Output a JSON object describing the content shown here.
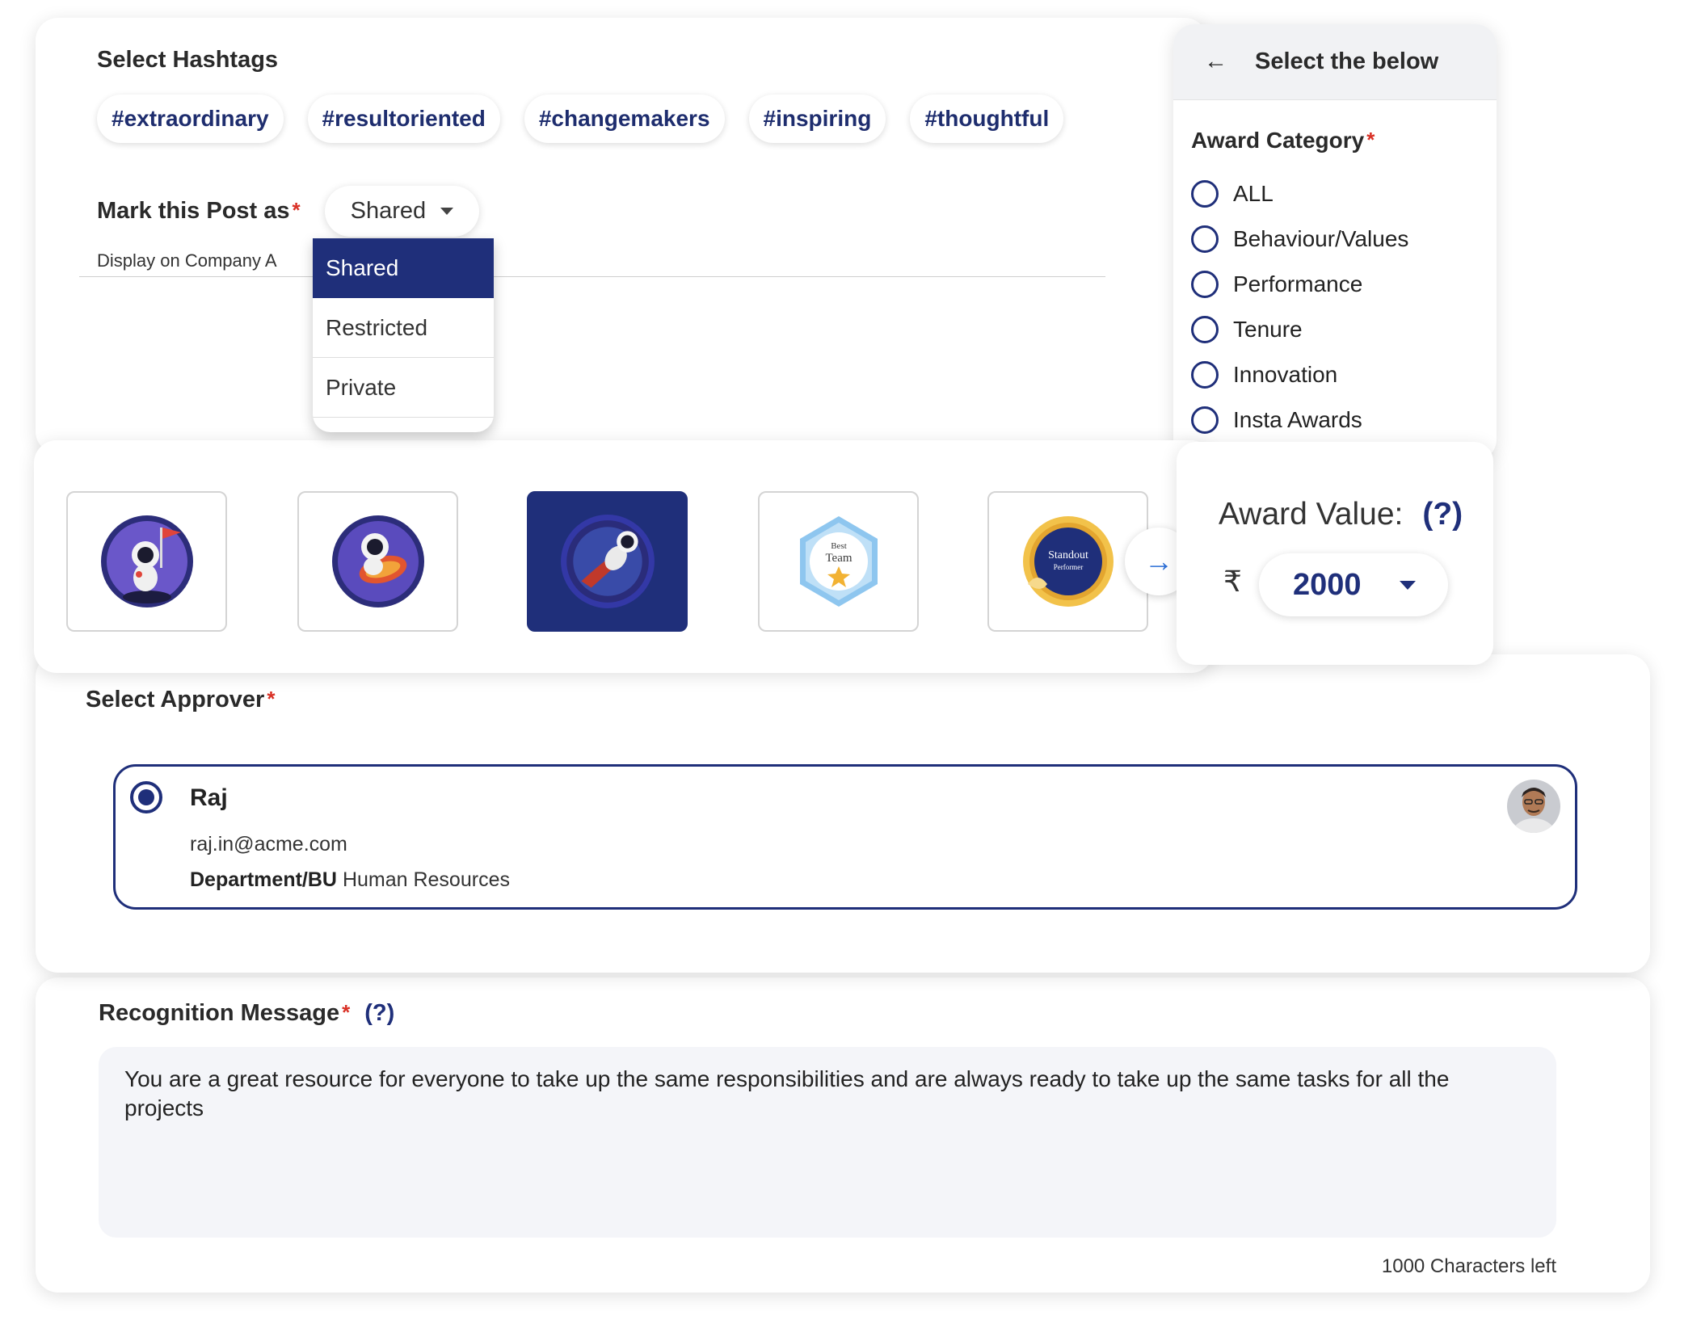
{
  "hashtags": {
    "title": "Select Hashtags",
    "items": [
      "#extraordinary",
      "#resultoriented",
      "#changemakers",
      "#inspiring",
      "#thoughtful"
    ]
  },
  "post_visibility": {
    "label": "Mark this Post as",
    "required_mark": "*",
    "selected": "Shared",
    "display_text": "Display on Company A",
    "options": [
      "Shared",
      "Restricted",
      "Private"
    ]
  },
  "category_panel": {
    "header": "Select the below",
    "title": "Award Category",
    "required_mark": "*",
    "options": [
      "ALL",
      "Behaviour/Values",
      "Performance",
      "Tenure",
      "Innovation",
      "Insta Awards"
    ]
  },
  "badges": {
    "items": [
      {
        "name": "astronaut-flag-badge"
      },
      {
        "name": "astronaut-rocket-badge"
      },
      {
        "name": "astronaut-flying-badge",
        "selected": true
      },
      {
        "name": "best-team-badge",
        "text_line1": "Best",
        "text_line2": "Team"
      },
      {
        "name": "standout-performer-badge",
        "text_line1": "Standout",
        "text_line2": "Performer"
      }
    ],
    "next_icon": "arrow-right-icon"
  },
  "award_value": {
    "label": "Award Value:",
    "help": "(?)",
    "currency": "₹",
    "value": "2000"
  },
  "approver": {
    "title": "Select Approver",
    "required_mark": "*",
    "name": "Raj",
    "email": "raj.in@acme.com",
    "dept_label": "Department/BU",
    "dept_value": "Human Resources"
  },
  "message": {
    "title": "Recognition Message",
    "required_mark": "*",
    "help": "(?)",
    "text": "You are a great resource for everyone to take up the same responsibilities and are always ready to take up the same tasks for all the projects",
    "chars_left": "1000 Characters left"
  },
  "colors": {
    "primary": "#1f2f7a",
    "required": "#d93025",
    "link_blue": "#2d6fd6"
  }
}
